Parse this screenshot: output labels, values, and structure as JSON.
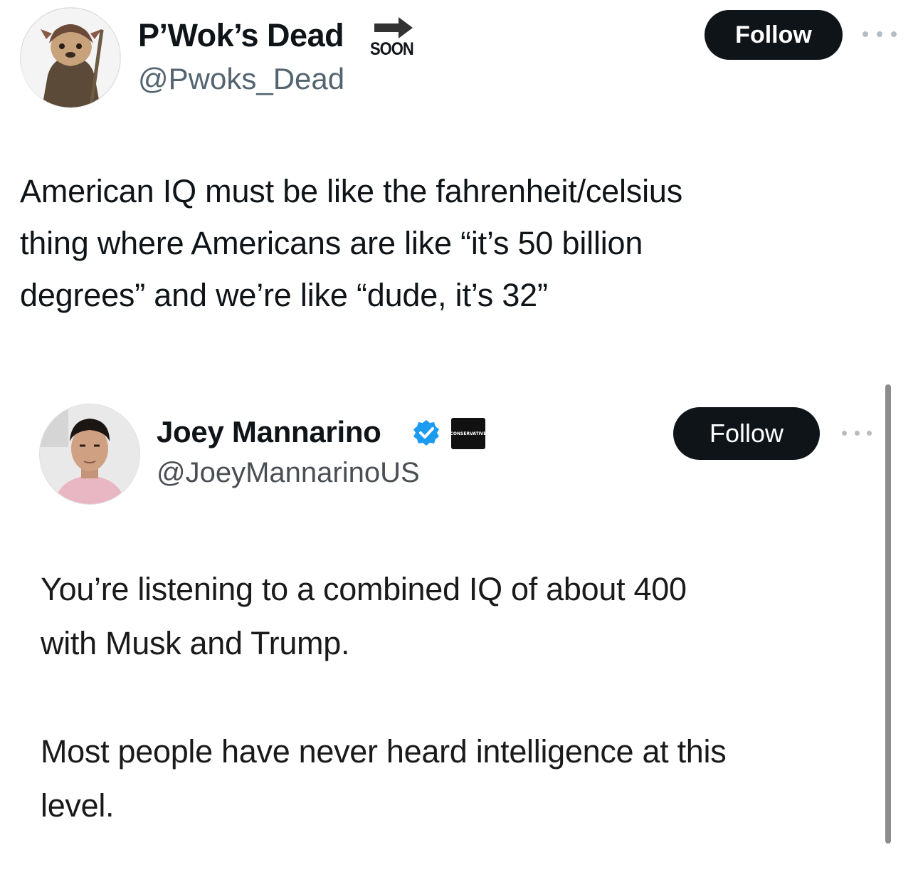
{
  "outer_tweet": {
    "display_name": "P’Wok’s Dead",
    "badge_text": "SOON",
    "handle": "@Pwoks_Dead",
    "follow_label": "Follow",
    "more_icon": "more-horizontal-icon",
    "text_lines": [
      "American IQ must be like the fahrenheit/celsius",
      "thing where Americans are like “it’s 50 billion",
      "degrees” and we’re like “dude, it’s 32”"
    ]
  },
  "quoted_tweet": {
    "display_name": "Joey Mannarino",
    "verified_icon": "verified-badge-icon",
    "affiliate_badge_text": "CONSERVATIVE",
    "handle": "@JoeyMannarinoUS",
    "follow_label": "Follow",
    "more_icon": "more-horizontal-icon",
    "paragraph_1_lines": [
      "You’re listening to a combined IQ of about 400",
      "with Musk and Trump."
    ],
    "paragraph_2_lines": [
      "Most people have never heard intelligence at this",
      "level."
    ]
  },
  "colors": {
    "text": "#0f1419",
    "secondary_text": "#536471",
    "button_bg": "#0f1419",
    "button_text": "#ffffff",
    "verified_blue": "#1d9bf0"
  }
}
